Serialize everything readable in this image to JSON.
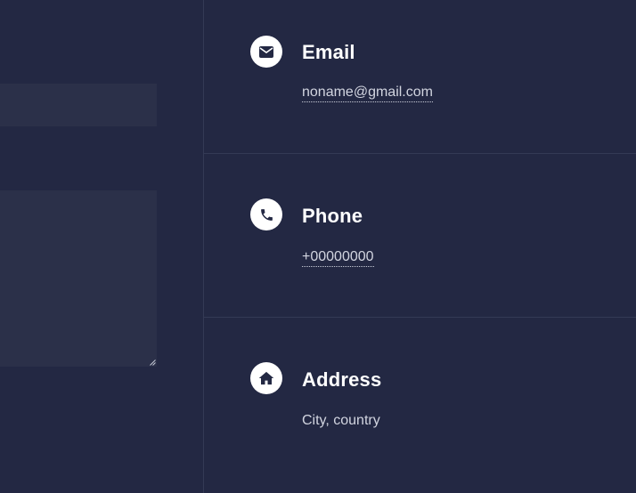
{
  "contacts": {
    "email": {
      "title": "Email",
      "value": "noname@gmail.com",
      "icon": "envelope-icon"
    },
    "phone": {
      "title": "Phone",
      "value": "+00000000",
      "icon": "phone-icon"
    },
    "address": {
      "title": "Address",
      "value": "City, country",
      "icon": "home-icon"
    }
  },
  "colors": {
    "background": "#232843",
    "field": "#2b3049",
    "divider": "#343a55",
    "text": "#ffffff",
    "muted_text": "#d2d5e0"
  }
}
